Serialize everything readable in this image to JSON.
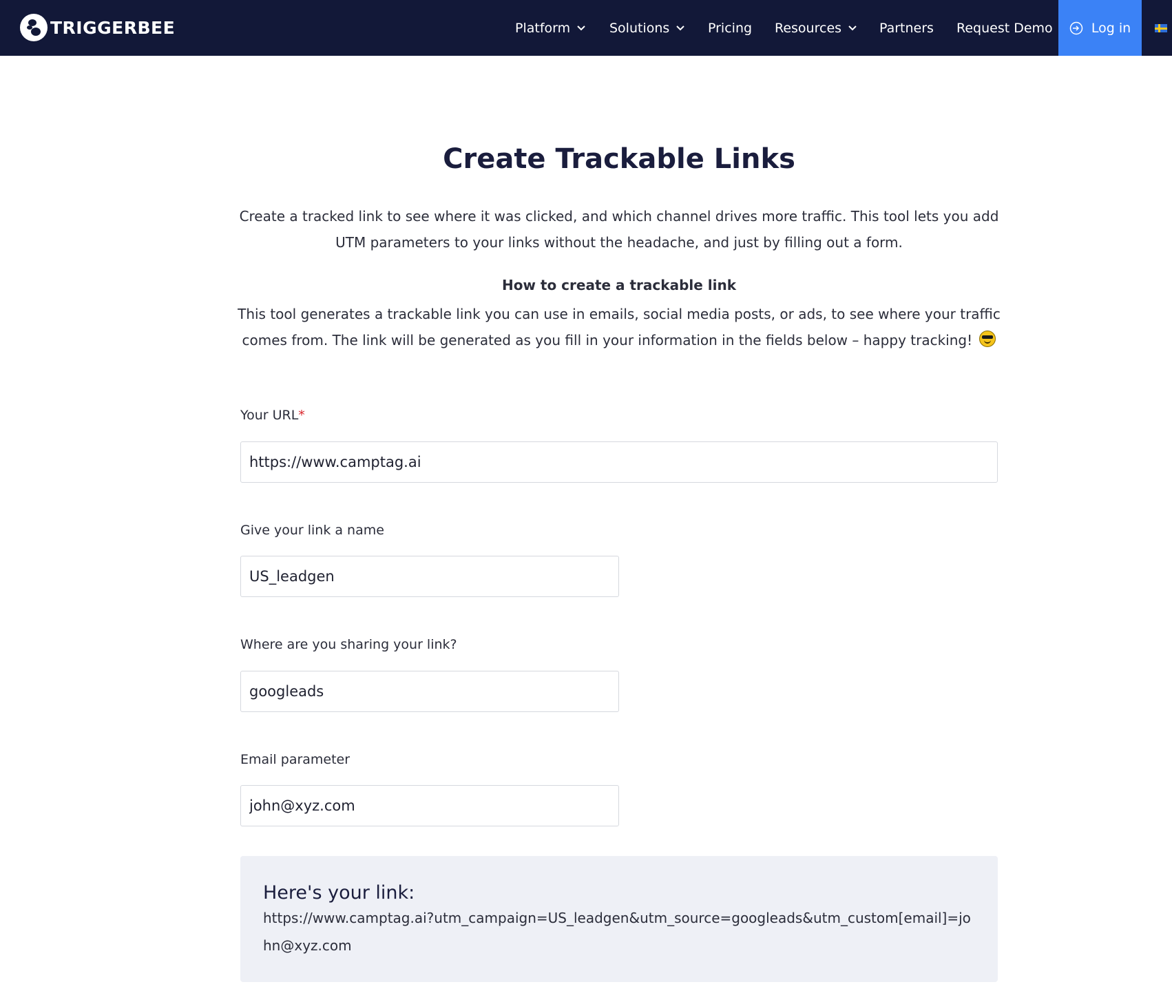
{
  "nav": {
    "logo_text": "TRIGGERBEE",
    "items": {
      "platform": "Platform",
      "solutions": "Solutions",
      "pricing": "Pricing",
      "resources": "Resources",
      "partners": "Partners",
      "request_demo": "Request Demo"
    },
    "login_label": "Log in",
    "colors": {
      "background": "#121838",
      "login": "#3b82f6"
    }
  },
  "page": {
    "title": "Create Trackable Links",
    "intro": "Create a tracked link to see where it was clicked, and which channel drives more traffic. This tool lets you add UTM parameters to your links without the headache, and just by filling out a form.",
    "howto_title": "How to create a trackable link",
    "howto_body": "This tool generates a trackable link you can use in emails, social media posts, or ads, to see where your traffic comes from. The link will be generated as you fill in your information in the fields below – happy tracking!",
    "howto_emoji": "smiling-face-with-sunglasses-icon"
  },
  "form": {
    "url": {
      "label": "Your URL",
      "required_mark": "*",
      "value": "https://www.camptag.ai"
    },
    "name": {
      "label": "Give your link a name",
      "value": "US_leadgen"
    },
    "source": {
      "label": "Where are you sharing your link?",
      "value": "googleads"
    },
    "email": {
      "label": "Email parameter",
      "value": "john@xyz.com"
    }
  },
  "result": {
    "title": "Here's your link:",
    "link": "https://www.camptag.ai?utm_campaign=US_leadgen&utm_source=googleads&utm_custom[email]=john@xyz.com"
  }
}
